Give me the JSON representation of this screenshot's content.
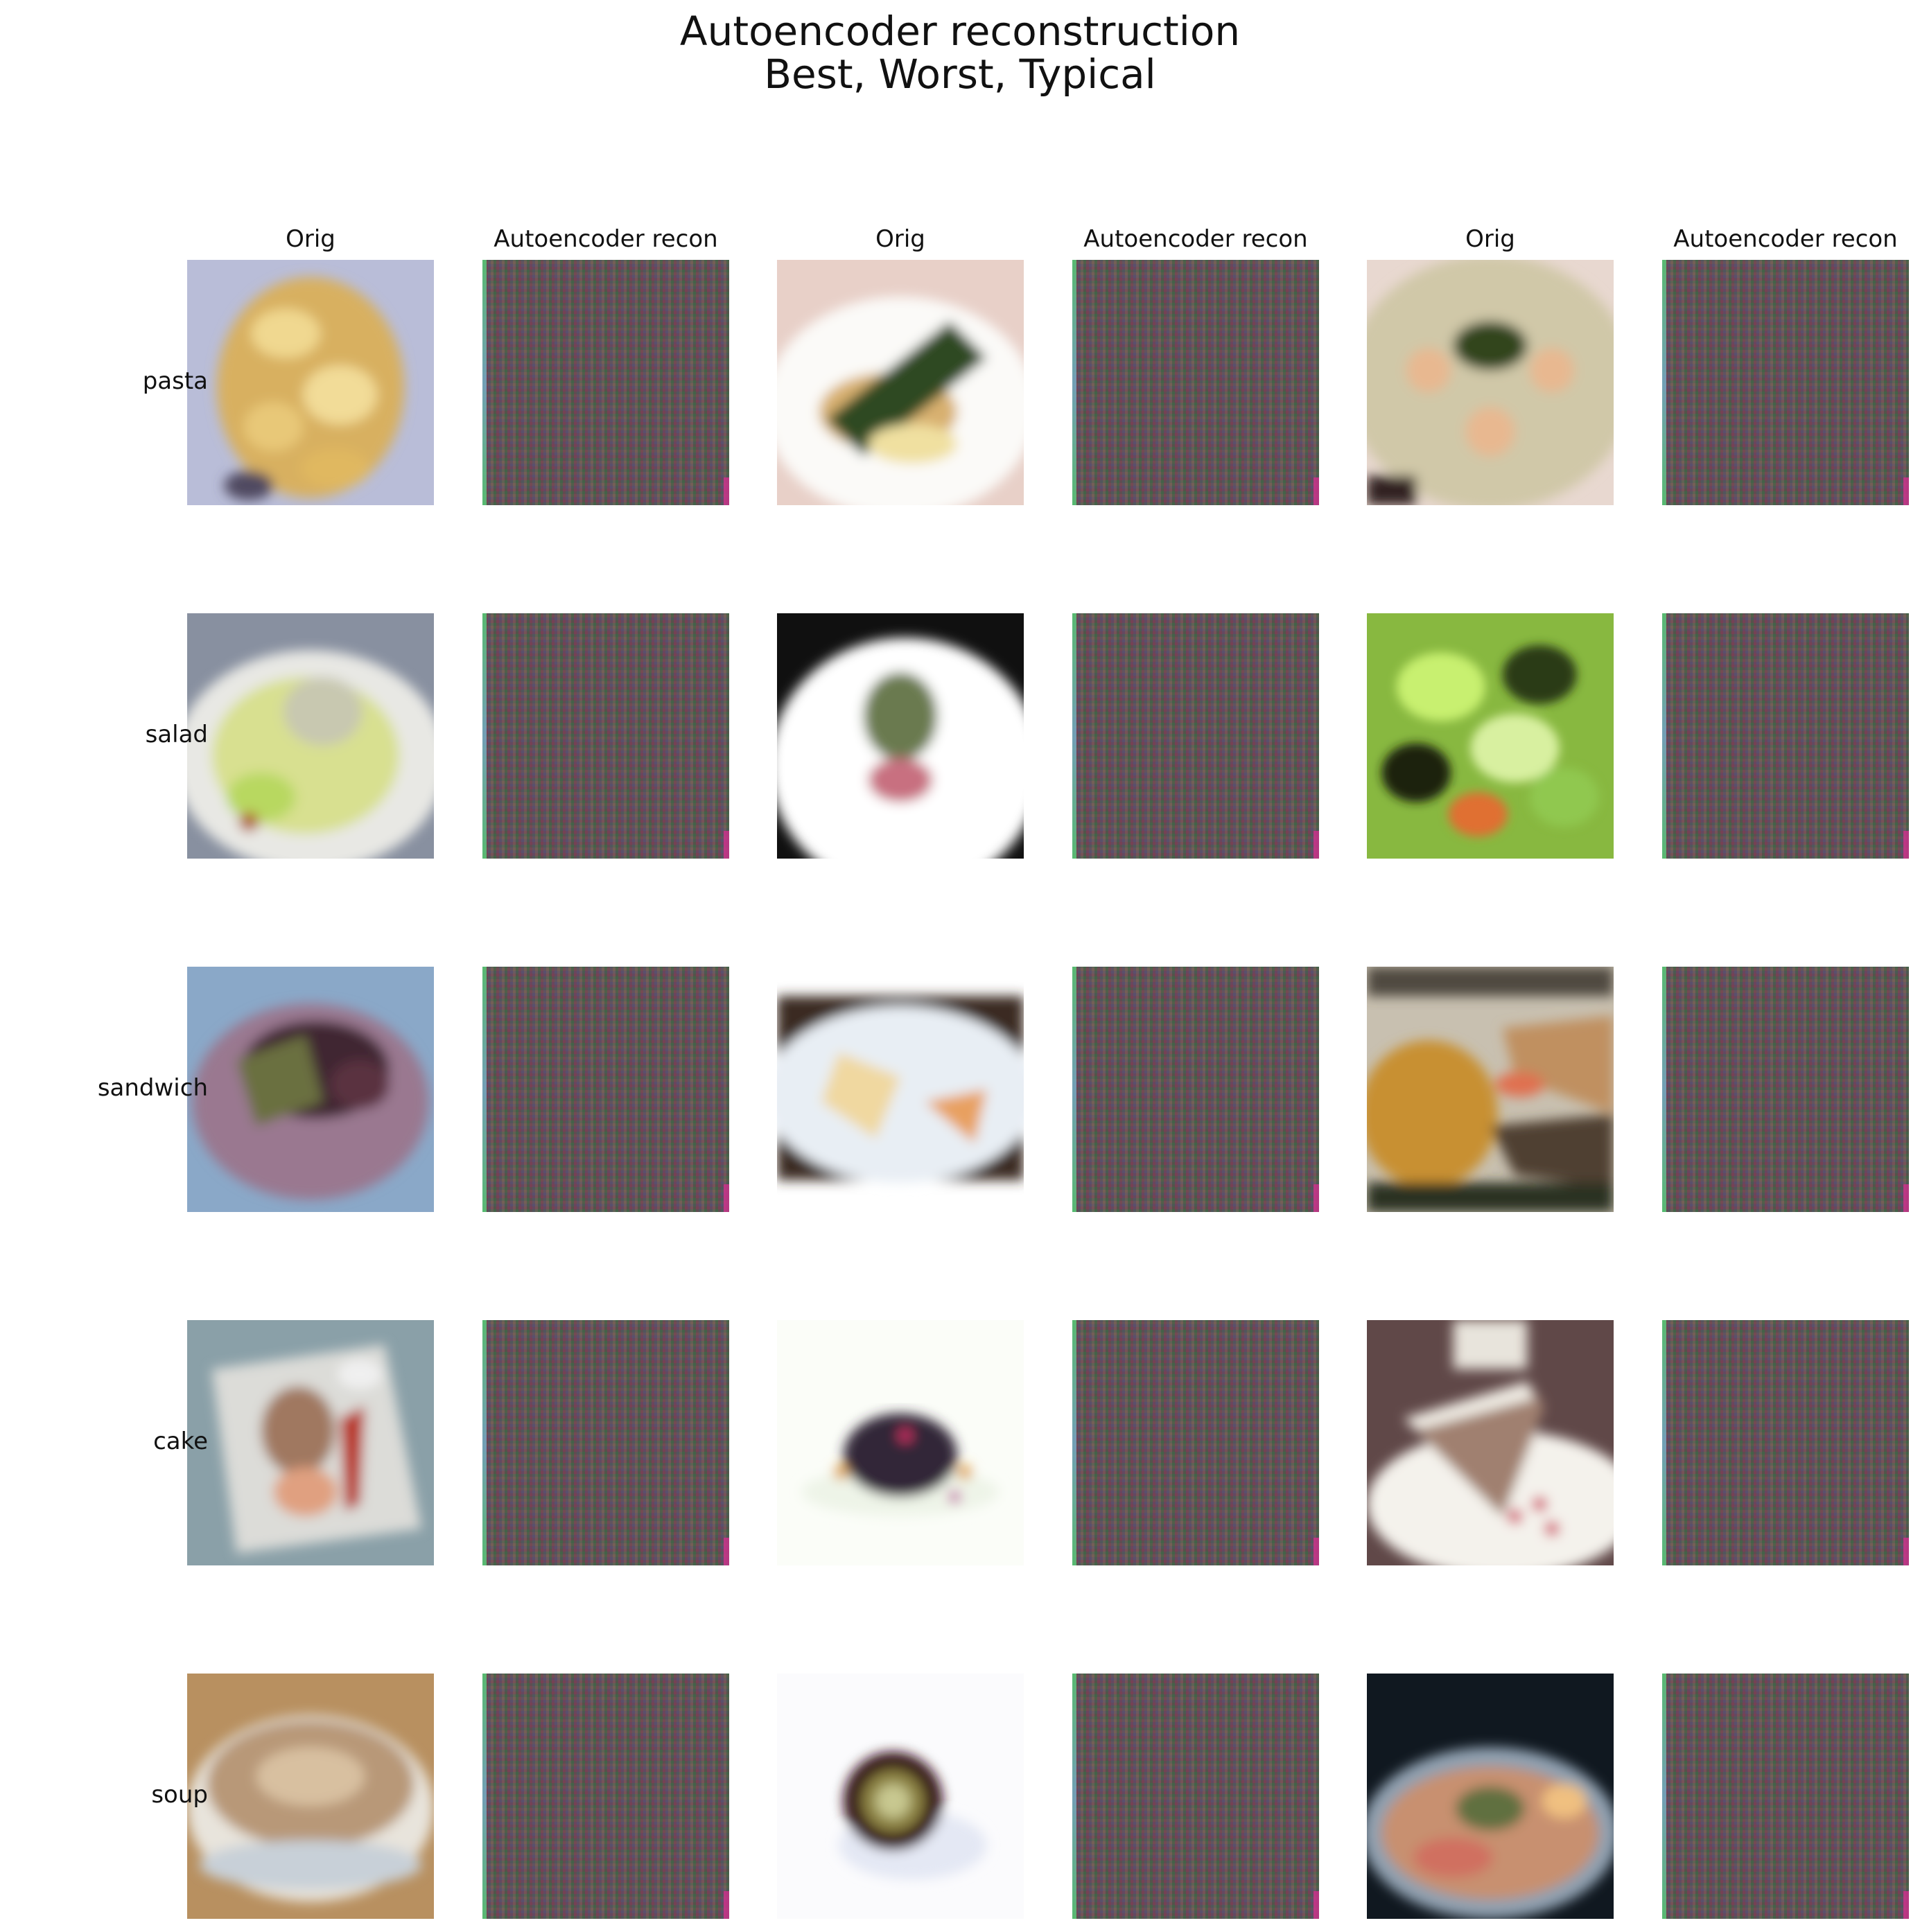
{
  "figure": {
    "title_line1": "Autoencoder reconstruction",
    "title_line2": "Best, Worst, Typical"
  },
  "column_headers": [
    "Orig",
    "Autoencoder recon",
    "Orig",
    "Autoencoder recon",
    "Orig",
    "Autoencoder recon"
  ],
  "row_labels": [
    "pasta",
    "salad",
    "sandwich",
    "cake",
    "soup"
  ]
}
